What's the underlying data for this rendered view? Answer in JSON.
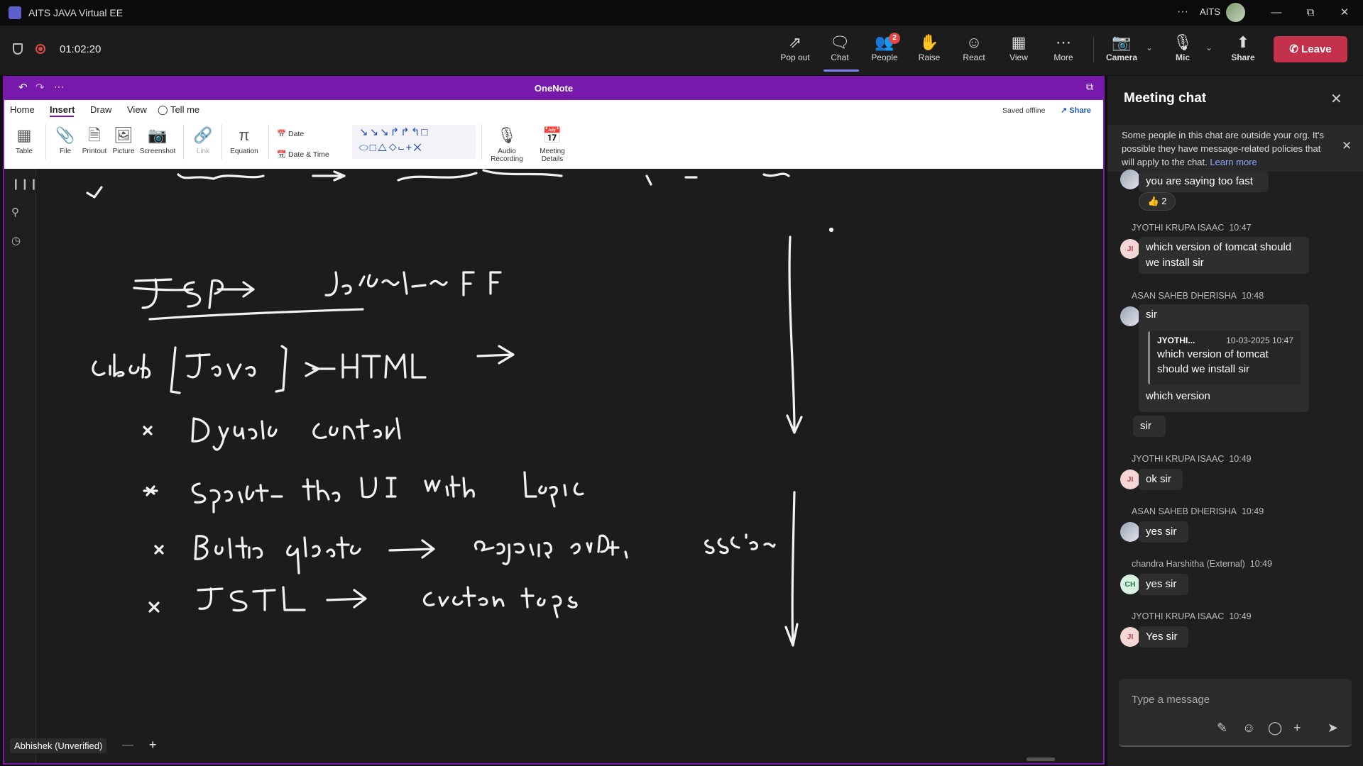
{
  "window": {
    "title": "AITS JAVA Virtual EE",
    "org": "AITS",
    "more_label": "···"
  },
  "meeting": {
    "timer": "01:02:20",
    "toolbar": [
      {
        "label": "Pop out",
        "icon": "pop-out-icon"
      },
      {
        "label": "Chat",
        "icon": "chat-icon"
      },
      {
        "label": "People",
        "icon": "people-icon"
      },
      {
        "label": "Raise",
        "icon": "hand-icon"
      },
      {
        "label": "React",
        "icon": "smile-icon"
      },
      {
        "label": "View",
        "icon": "grid-icon"
      },
      {
        "label": "More",
        "icon": "more-icon"
      },
      {
        "label": "Camera",
        "icon": "camera-off-icon"
      },
      {
        "label": "Mic",
        "icon": "mic-off-icon"
      },
      {
        "label": "Share",
        "icon": "share-icon"
      }
    ],
    "people_badge": "2",
    "leave_label": "Leave",
    "accent": "#7f85f5",
    "leave_color": "#c4314b"
  },
  "onenote": {
    "title": "OneNote",
    "tabs": [
      "Home",
      "Insert",
      "Draw",
      "View",
      "Tell me"
    ],
    "active_tab": "Insert",
    "saved_status": "Saved offline",
    "share_label": "Share",
    "ribbon": {
      "table": "Table",
      "file": "File",
      "printout": "Printout",
      "picture": "Picture",
      "screenshot": "Screenshot",
      "link": "Link",
      "equation": "Equation",
      "date": "Date",
      "date_time": "Date & Time",
      "audio_line1": "Audio",
      "audio_line2": "Recording",
      "meeting_line1": "Meeting",
      "meeting_line2": "Details"
    },
    "presenter": "Abhishek (Unverified)",
    "zoom_out": "—",
    "zoom_in": "+",
    "brand_color": "#7719aa"
  },
  "chat": {
    "title": "Meeting chat",
    "notice": "Some people in this chat are outside your org. It's possible they have message-related policies that will apply to the chat.",
    "notice_link": "Learn more",
    "reaction": {
      "emoji": "👍",
      "count": "2"
    },
    "messages": [
      {
        "sender": "",
        "time": "",
        "text": "you are saying too fast"
      },
      {
        "sender": "JYOTHI KRUPA ISAAC",
        "time": "10:47",
        "initials": "JI",
        "text": "which version of tomcat should we install sir"
      },
      {
        "sender": "ASAN SAHEB DHERISHA",
        "time": "10:48",
        "text": "sir",
        "quote": {
          "author": "JYOTHI...",
          "time": "10-03-2025 10:47",
          "text": "which version of tomcat should we install sir"
        },
        "after_quote": "which version",
        "extra": "sir"
      },
      {
        "sender": "JYOTHI KRUPA ISAAC",
        "time": "10:49",
        "initials": "JI",
        "text": "ok sir"
      },
      {
        "sender": "ASAN SAHEB DHERISHA",
        "time": "10:49",
        "text": "yes sir"
      },
      {
        "sender": "chandra Harshitha (External)",
        "time": "10:49",
        "initials": "CH",
        "text": "yes sir"
      },
      {
        "sender": "JYOTHI KRUPA ISAAC",
        "time": "10:49",
        "initials": "JI",
        "text": "Yes sir"
      }
    ],
    "compose_placeholder": "Type a message"
  }
}
